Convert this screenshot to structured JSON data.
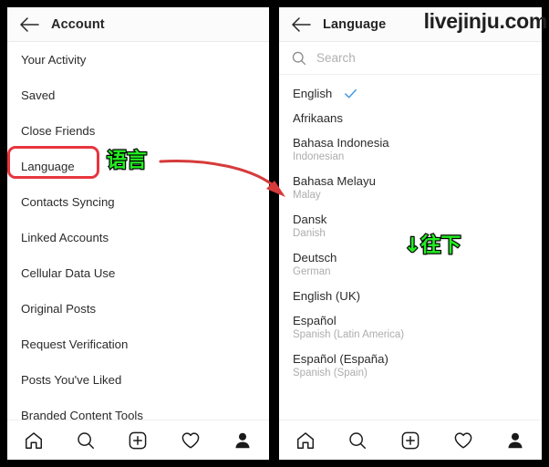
{
  "watermark": "livejinju.com",
  "left_panel": {
    "header": {
      "back_icon": "back-arrow-icon",
      "title": "Account"
    },
    "items": [
      {
        "label": "Your Activity"
      },
      {
        "label": "Saved"
      },
      {
        "label": "Close Friends"
      },
      {
        "label": "Language"
      },
      {
        "label": "Contacts Syncing"
      },
      {
        "label": "Linked Accounts"
      },
      {
        "label": "Cellular Data Use"
      },
      {
        "label": "Original Posts"
      },
      {
        "label": "Request Verification"
      },
      {
        "label": "Posts You've Liked"
      },
      {
        "label": "Branded Content Tools"
      }
    ]
  },
  "right_panel": {
    "header": {
      "back_icon": "back-arrow-icon",
      "title": "Language"
    },
    "search": {
      "placeholder": "Search",
      "value": "",
      "icon": "search-icon"
    },
    "languages": [
      {
        "name": "English",
        "sub": "",
        "selected": true
      },
      {
        "name": "Afrikaans",
        "sub": "",
        "selected": false
      },
      {
        "name": "Bahasa Indonesia",
        "sub": "Indonesian",
        "selected": false
      },
      {
        "name": "Bahasa Melayu",
        "sub": "Malay",
        "selected": false
      },
      {
        "name": "Dansk",
        "sub": "Danish",
        "selected": false
      },
      {
        "name": "Deutsch",
        "sub": "German",
        "selected": false
      },
      {
        "name": "English (UK)",
        "sub": "",
        "selected": false
      },
      {
        "name": "Español",
        "sub": "Spanish (Latin America)",
        "selected": false
      },
      {
        "name": "Español (España)",
        "sub": "Spanish (Spain)",
        "selected": false
      }
    ]
  },
  "bottom_nav": [
    {
      "icon": "home-icon"
    },
    {
      "icon": "search-icon"
    },
    {
      "icon": "add-post-icon"
    },
    {
      "icon": "heart-icon"
    },
    {
      "icon": "profile-icon"
    }
  ],
  "annotations": {
    "language_callout": "语言",
    "scroll_down_callout": "↓往下",
    "highlight_color": "#e8353e",
    "callout_color": "#22ee22"
  }
}
